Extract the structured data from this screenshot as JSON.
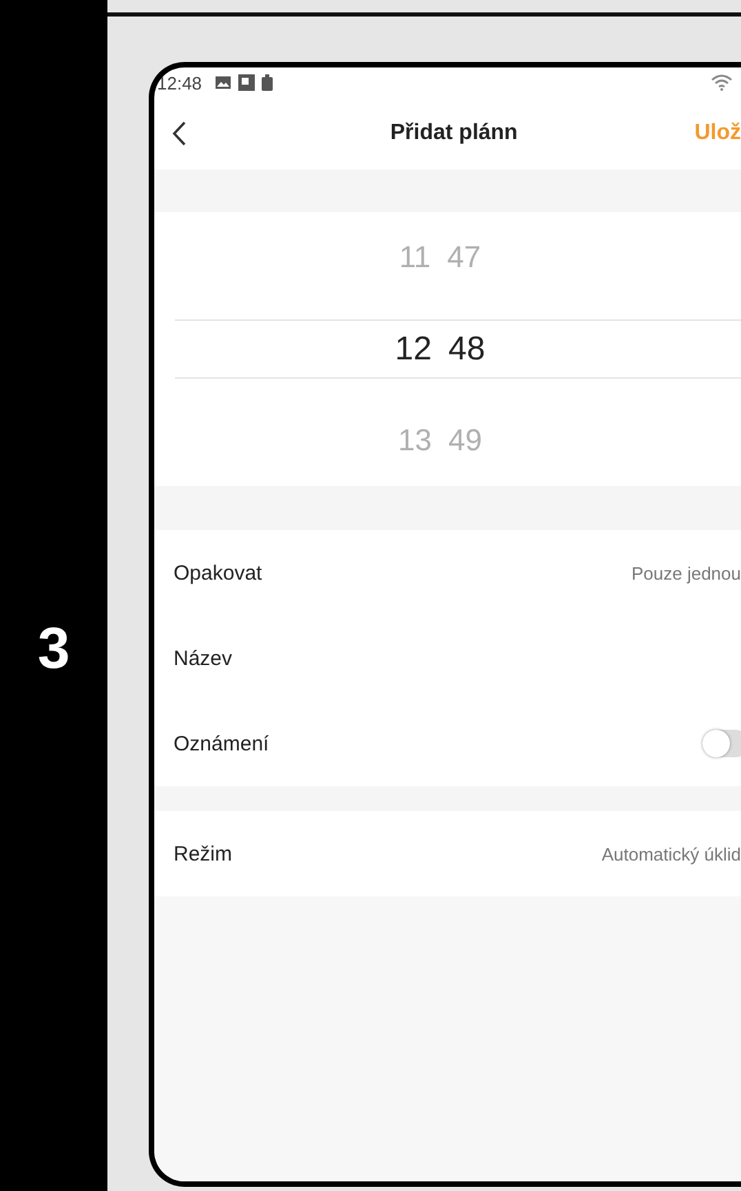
{
  "step": "3",
  "status_bar": {
    "time": "12:48"
  },
  "nav": {
    "title": "Přidat plánn",
    "action": "Ulož"
  },
  "picker": [
    {
      "hour": "11",
      "minute": "47",
      "selected": false
    },
    {
      "hour": "12",
      "minute": "48",
      "selected": true
    },
    {
      "hour": "13",
      "minute": "49",
      "selected": false
    }
  ],
  "settings": [
    {
      "label": "Opakovat",
      "kind": "value",
      "value": "Pouze jednou"
    },
    {
      "label": "Název",
      "kind": "blank"
    },
    {
      "label": "Oznámení",
      "kind": "toggle",
      "on": false
    }
  ],
  "mode": {
    "label": "Režim",
    "value": "Automatický úklid"
  }
}
